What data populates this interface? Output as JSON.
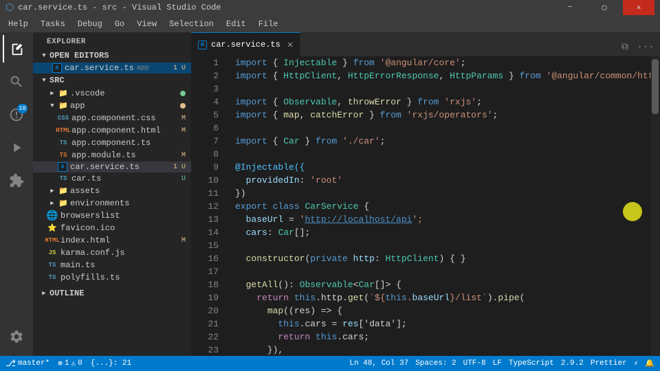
{
  "titleBar": {
    "title": "car.service.ts - src - Visual Studio Code",
    "icon": "A"
  },
  "menuBar": {
    "items": [
      "Help",
      "Tasks",
      "Debug",
      "Go",
      "View",
      "Selection",
      "Edit",
      "File"
    ]
  },
  "activityBar": {
    "icons": [
      {
        "name": "explorer",
        "symbol": "⎘",
        "active": true
      },
      {
        "name": "search",
        "symbol": "🔍"
      },
      {
        "name": "source-control",
        "symbol": "⎇",
        "badge": "10"
      },
      {
        "name": "run",
        "symbol": "▷"
      },
      {
        "name": "extensions",
        "symbol": "⧉"
      },
      {
        "name": "settings",
        "symbol": "⚙",
        "bottom": true
      }
    ]
  },
  "sidebar": {
    "header": "EXPLORER",
    "sections": [
      {
        "name": "OPEN EDITORS",
        "expanded": true,
        "items": [
          {
            "indent": 1,
            "icon": "A",
            "iconColor": "#007acc",
            "label": "car.service.ts",
            "tag": "app",
            "badge": "1 U",
            "active": true
          }
        ]
      },
      {
        "name": "SRC",
        "expanded": true,
        "items": [
          {
            "indent": 1,
            "icon": "📁",
            "iconColor": "#e8ab53",
            "label": ".vscode",
            "badge": "",
            "dot": "green"
          },
          {
            "indent": 1,
            "icon": "📁",
            "iconColor": "#e8ab53",
            "label": "app",
            "badge": "",
            "dot": "orange"
          },
          {
            "indent": 2,
            "icon": "CSS",
            "iconColor": "#519aba",
            "label": "app.component.css",
            "badge": "M"
          },
          {
            "indent": 2,
            "icon": "HTML",
            "iconColor": "#e37933",
            "label": "app.component.html",
            "badge": "M"
          },
          {
            "indent": 2,
            "icon": "TS",
            "iconColor": "#519aba",
            "label": "app.component.ts",
            "badge": ""
          },
          {
            "indent": 2,
            "icon": "TS",
            "iconColor": "#e37933",
            "label": "app.module.ts",
            "badge": "M"
          },
          {
            "indent": 2,
            "icon": "A",
            "iconColor": "#007acc",
            "label": "car.service.ts",
            "badge": "1 U",
            "active": true
          },
          {
            "indent": 2,
            "icon": "TS",
            "iconColor": "#519aba",
            "label": "car.ts",
            "badge": "U"
          },
          {
            "indent": 1,
            "icon": "📁",
            "iconColor": "#e8ab53",
            "label": "assets",
            "badge": ""
          },
          {
            "indent": 1,
            "icon": "📁",
            "iconColor": "#e8ab53",
            "label": "environments",
            "badge": ""
          },
          {
            "indent": 1,
            "icon": "🌐",
            "iconColor": "#8bc34a",
            "label": "browserslist",
            "badge": ""
          },
          {
            "indent": 1,
            "icon": "⭐",
            "iconColor": "#f9c74f",
            "label": "favicon.ico",
            "badge": ""
          },
          {
            "indent": 1,
            "icon": "HTML",
            "iconColor": "#e37933",
            "label": "index.html",
            "badge": "M"
          },
          {
            "indent": 1,
            "icon": "JS",
            "iconColor": "#cbcb41",
            "label": "karma.conf.js",
            "badge": ""
          },
          {
            "indent": 1,
            "icon": "TS",
            "iconColor": "#519aba",
            "label": "main.ts",
            "badge": ""
          },
          {
            "indent": 1,
            "icon": "TS",
            "iconColor": "#519aba",
            "label": "polyfills.ts",
            "badge": ""
          }
        ]
      }
    ],
    "outline": "OUTLINE"
  },
  "editor": {
    "tab": {
      "icon": "A",
      "filename": "car.service.ts",
      "closeable": true
    },
    "lines": [
      {
        "num": 1,
        "tokens": [
          {
            "t": "import",
            "c": "kw"
          },
          {
            "t": " { ",
            "c": "op"
          },
          {
            "t": "Injectable",
            "c": "cls"
          },
          {
            "t": " } ",
            "c": "op"
          },
          {
            "t": "from",
            "c": "kw"
          },
          {
            "t": " '",
            "c": "str"
          },
          {
            "t": "@angular/core",
            "c": "str"
          },
          {
            "t": "';",
            "c": "str"
          }
        ]
      },
      {
        "num": 2,
        "tokens": [
          {
            "t": "import",
            "c": "kw"
          },
          {
            "t": " { ",
            "c": "op"
          },
          {
            "t": "HttpClient",
            "c": "cls"
          },
          {
            "t": ", ",
            "c": "op"
          },
          {
            "t": "HttpErrorResponse",
            "c": "cls"
          },
          {
            "t": ", ",
            "c": "op"
          },
          {
            "t": "HttpParams",
            "c": "cls"
          },
          {
            "t": " } ",
            "c": "op"
          },
          {
            "t": "from",
            "c": "kw"
          },
          {
            "t": " '",
            "c": "str"
          },
          {
            "t": "@angular/common/http",
            "c": "str"
          },
          {
            "t": "';",
            "c": "str"
          }
        ]
      },
      {
        "num": 3,
        "tokens": [
          {
            "t": "",
            "c": ""
          }
        ]
      },
      {
        "num": 4,
        "tokens": [
          {
            "t": "import",
            "c": "kw"
          },
          {
            "t": " { ",
            "c": "op"
          },
          {
            "t": "Observable",
            "c": "cls"
          },
          {
            "t": ", ",
            "c": "op"
          },
          {
            "t": "throwError",
            "c": "fn"
          },
          {
            "t": " } ",
            "c": "op"
          },
          {
            "t": "from",
            "c": "kw"
          },
          {
            "t": " '",
            "c": "str"
          },
          {
            "t": "rxjs",
            "c": "str"
          },
          {
            "t": "';",
            "c": "str"
          }
        ]
      },
      {
        "num": 5,
        "tokens": [
          {
            "t": "import",
            "c": "kw"
          },
          {
            "t": " { ",
            "c": "op"
          },
          {
            "t": "map",
            "c": "fn"
          },
          {
            "t": ", ",
            "c": "op"
          },
          {
            "t": "catchError",
            "c": "fn"
          },
          {
            "t": " } ",
            "c": "op"
          },
          {
            "t": "from",
            "c": "kw"
          },
          {
            "t": " '",
            "c": "str"
          },
          {
            "t": "rxjs/operators",
            "c": "str"
          },
          {
            "t": "';",
            "c": "str"
          }
        ]
      },
      {
        "num": 6,
        "tokens": [
          {
            "t": "",
            "c": ""
          }
        ]
      },
      {
        "num": 7,
        "tokens": [
          {
            "t": "import",
            "c": "kw"
          },
          {
            "t": " { ",
            "c": "op"
          },
          {
            "t": "Car",
            "c": "cls"
          },
          {
            "t": " } ",
            "c": "op"
          },
          {
            "t": "from",
            "c": "kw"
          },
          {
            "t": " '",
            "c": "str"
          },
          {
            "t": "./car",
            "c": "str"
          },
          {
            "t": "';",
            "c": "str"
          }
        ]
      },
      {
        "num": 8,
        "tokens": [
          {
            "t": "",
            "c": ""
          }
        ]
      },
      {
        "num": 9,
        "tokens": [
          {
            "t": "@Injectable({",
            "c": "dec"
          }
        ]
      },
      {
        "num": 10,
        "tokens": [
          {
            "t": "  providedIn",
            "c": "prop"
          },
          {
            "t": ": ",
            "c": "op"
          },
          {
            "t": "'root'",
            "c": "str"
          }
        ]
      },
      {
        "num": 11,
        "tokens": [
          {
            "t": "})",
            "c": "op"
          }
        ]
      },
      {
        "num": 12,
        "tokens": [
          {
            "t": "export",
            "c": "kw"
          },
          {
            "t": " ",
            "c": ""
          },
          {
            "t": "class",
            "c": "kw"
          },
          {
            "t": " ",
            "c": ""
          },
          {
            "t": "CarService",
            "c": "cls"
          },
          {
            "t": " {",
            "c": "op"
          }
        ]
      },
      {
        "num": 13,
        "tokens": [
          {
            "t": "  baseUrl",
            "c": "prop"
          },
          {
            "t": " = ",
            "c": "op"
          },
          {
            "t": "'",
            "c": "str"
          },
          {
            "t": "http://localhost/api",
            "c": "link"
          },
          {
            "t": "';",
            "c": "str"
          }
        ]
      },
      {
        "num": 14,
        "tokens": [
          {
            "t": "  cars",
            "c": "prop"
          },
          {
            "t": ": ",
            "c": "op"
          },
          {
            "t": "Car",
            "c": "cls"
          },
          {
            "t": "[];",
            "c": "op"
          }
        ]
      },
      {
        "num": 15,
        "tokens": [
          {
            "t": "",
            "c": ""
          }
        ]
      },
      {
        "num": 16,
        "tokens": [
          {
            "t": "  constructor",
            "c": "fn"
          },
          {
            "t": "(",
            "c": "op"
          },
          {
            "t": "private",
            "c": "kw"
          },
          {
            "t": " http",
            "c": "prop"
          },
          {
            "t": ": ",
            "c": "op"
          },
          {
            "t": "HttpClient",
            "c": "cls"
          },
          {
            "t": ") { }",
            "c": "op"
          }
        ]
      },
      {
        "num": 17,
        "tokens": [
          {
            "t": "",
            "c": ""
          }
        ]
      },
      {
        "num": 18,
        "tokens": [
          {
            "t": "  getAll",
            "c": "fn"
          },
          {
            "t": "(): ",
            "c": "op"
          },
          {
            "t": "Observable",
            "c": "cls"
          },
          {
            "t": "<",
            "c": "op"
          },
          {
            "t": "Car",
            "c": "cls"
          },
          {
            "t": "[]> {",
            "c": "op"
          }
        ]
      },
      {
        "num": 19,
        "tokens": [
          {
            "t": "    return",
            "c": "kw2"
          },
          {
            "t": " ",
            "c": ""
          },
          {
            "t": "this",
            "c": "kw"
          },
          {
            "t": ".http.",
            "c": "op"
          },
          {
            "t": "get",
            "c": "fn"
          },
          {
            "t": "(`",
            "c": "str"
          },
          {
            "t": "${",
            "c": "op"
          },
          {
            "t": "this",
            "c": "kw"
          },
          {
            "t": ".baseUrl",
            "c": "prop"
          },
          {
            "t": "}/list",
            "c": "str"
          },
          {
            "t": "`)",
            "c": "str"
          },
          {
            "t": ".",
            "c": "op"
          },
          {
            "t": "pipe",
            "c": "fn"
          },
          {
            "t": "(",
            "c": "op"
          }
        ]
      },
      {
        "num": 20,
        "tokens": [
          {
            "t": "      map",
            "c": "fn"
          },
          {
            "t": "((res) => {",
            "c": "op"
          }
        ]
      },
      {
        "num": 21,
        "tokens": [
          {
            "t": "        this",
            "c": "kw"
          },
          {
            "t": ".cars = ",
            "c": "op"
          },
          {
            "t": "res",
            "c": "prop"
          },
          {
            "t": "['data'];",
            "c": "op"
          }
        ]
      },
      {
        "num": 22,
        "tokens": [
          {
            "t": "        return",
            "c": "kw2"
          },
          {
            "t": " ",
            "c": ""
          },
          {
            "t": "this",
            "c": "kw"
          },
          {
            "t": ".cars;",
            "c": "op"
          }
        ]
      },
      {
        "num": 23,
        "tokens": [
          {
            "t": "      }),",
            "c": "op"
          }
        ]
      }
    ]
  },
  "statusBar": {
    "left": [
      {
        "text": "⎇ master*",
        "name": "git-branch"
      },
      {
        "text": "⊗ 1",
        "name": "errors"
      },
      {
        "text": "⚠ 0",
        "name": "warnings"
      },
      {
        "text": "{...}: 21",
        "name": "glyph-count"
      }
    ],
    "right": [
      {
        "text": "Ln 48, Col 37",
        "name": "cursor-position"
      },
      {
        "text": "Spaces: 2",
        "name": "indentation"
      },
      {
        "text": "UTF-8",
        "name": "encoding"
      },
      {
        "text": "LF",
        "name": "line-ending"
      },
      {
        "text": "TypeScript",
        "name": "language"
      },
      {
        "text": "2.9.2",
        "name": "ts-version"
      },
      {
        "text": "Prettier",
        "name": "formatter"
      },
      {
        "text": "⚡",
        "name": "lightning"
      },
      {
        "text": "🔔",
        "name": "bell"
      }
    ]
  }
}
